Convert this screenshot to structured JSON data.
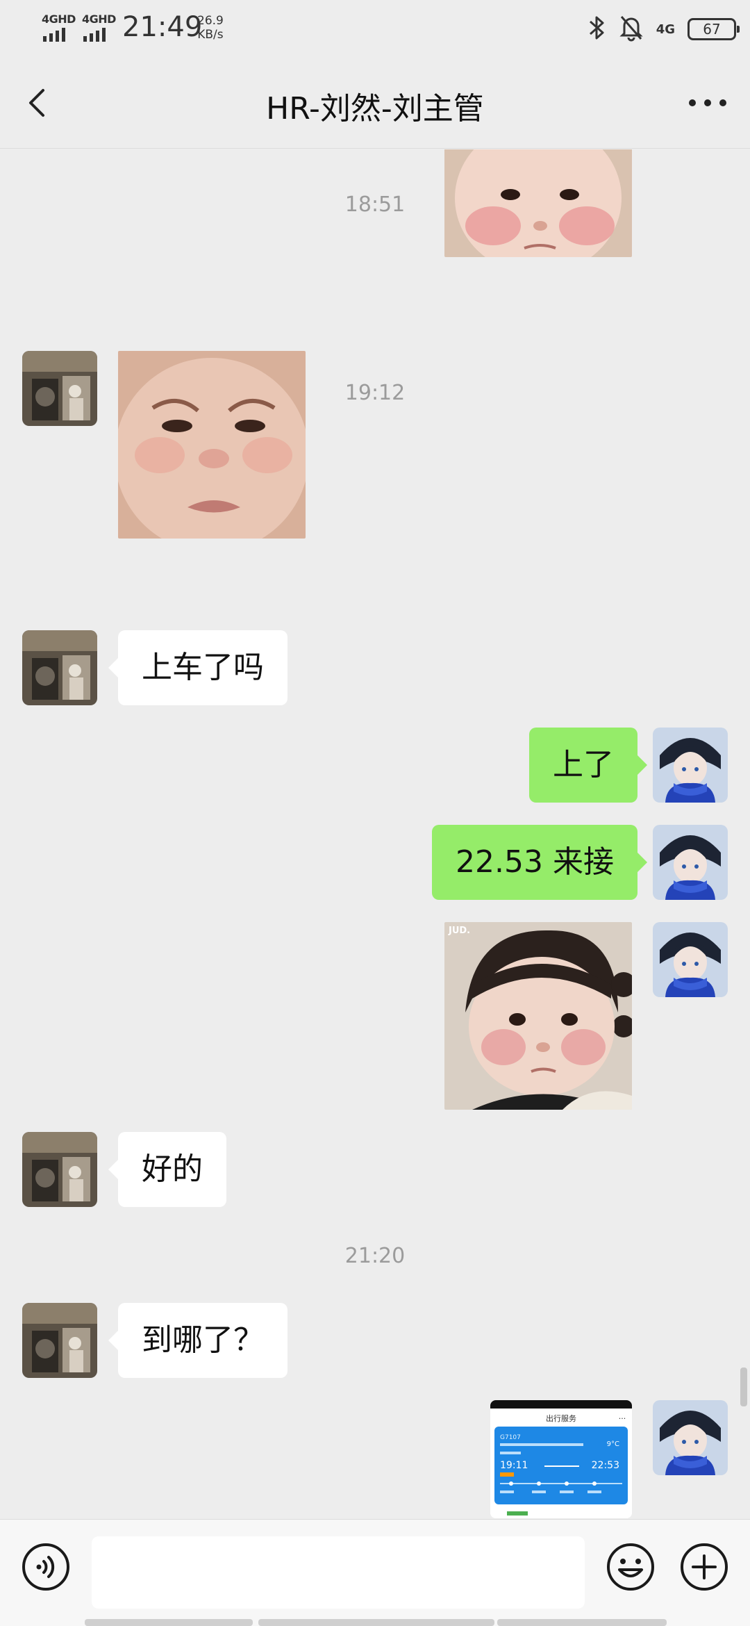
{
  "status_bar": {
    "sim1": "4GHD",
    "sim2": "4GHD",
    "time": "21:49",
    "speed_value": "26.9",
    "speed_unit": "KB/s",
    "network": "4G",
    "battery": "67",
    "icons": [
      "bluetooth-icon",
      "mute-bell-icon"
    ]
  },
  "header": {
    "title": "HR-刘然-刘主管",
    "back_icon": "chevron-left-icon",
    "more_icon": "more-dots-icon"
  },
  "messages": {
    "timestamps": [
      "18:51",
      "19:12",
      "21:20"
    ],
    "items": [
      {
        "side": "out",
        "type": "sticker",
        "desc": "baby-face-sticker"
      },
      {
        "side": "in",
        "type": "sticker",
        "desc": "baby-frown-sticker"
      },
      {
        "side": "in",
        "type": "text",
        "text": "上车了吗"
      },
      {
        "side": "out",
        "type": "text",
        "text": "上了"
      },
      {
        "side": "out",
        "type": "text",
        "text": "22.53 来接"
      },
      {
        "side": "out",
        "type": "sticker",
        "desc": "baby-pigtails-sticker"
      },
      {
        "side": "in",
        "type": "text",
        "text": "好的"
      },
      {
        "side": "in",
        "type": "text",
        "text": "到哪了？"
      },
      {
        "side": "out",
        "type": "image",
        "desc": "trip-screenshot"
      }
    ]
  },
  "trip_card": {
    "header": "出行服务",
    "left_code": "G7107",
    "weather": "9°C",
    "depart_time": "19:11",
    "arrive_time": "22:53"
  },
  "sticker_caption": "JUD.",
  "input_bar": {
    "placeholder": "",
    "voice_icon": "voice-icon",
    "emoji_icon": "emoji-icon",
    "plus_icon": "plus-icon"
  },
  "colors": {
    "background": "#ededed",
    "outgoing_bubble": "#95ec69",
    "incoming_bubble": "#ffffff",
    "timestamp": "#9b9b9b"
  }
}
